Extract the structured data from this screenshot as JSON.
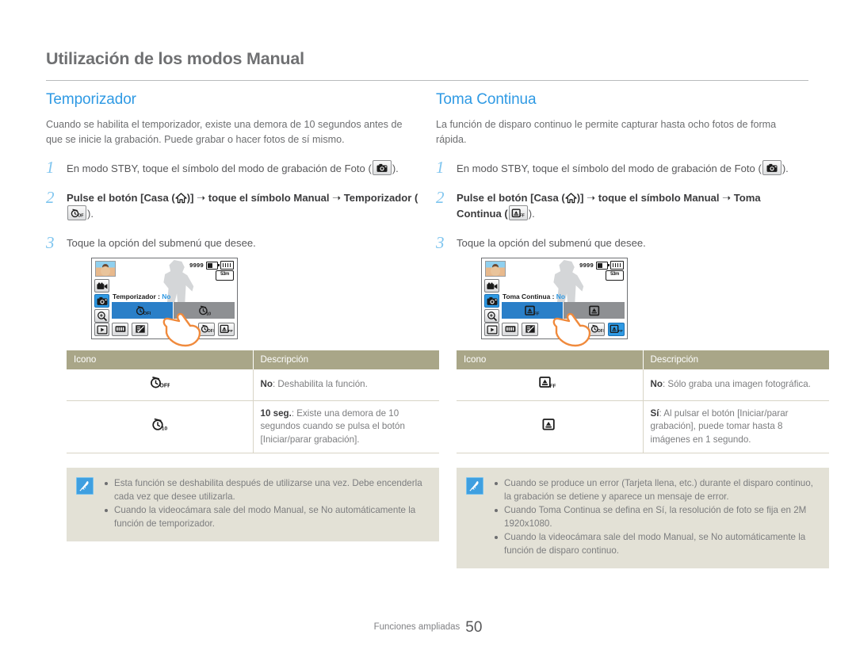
{
  "header": {
    "title": "Utilización de los modos Manual"
  },
  "footer": {
    "section": "Funciones ampliadas",
    "page": "50"
  },
  "left": {
    "heading": "Temporizador",
    "intro": "Cuando se habilita el temporizador, existe una demora de 10 segundos antes de que se inicie la grabación. Puede grabar o hacer fotos de sí mismo.",
    "steps": [
      {
        "num": "1",
        "html_pre": "En modo STBY, toque el símbolo del modo de grabación de Foto (",
        "html_post": ")."
      },
      {
        "num": "2",
        "html_pre": "Pulse el botón [Casa (",
        "mid": ")] ➝ toque el símbolo Manual ➝ Temporizador (",
        "html_post": ")."
      },
      {
        "num": "3",
        "text": "Toque la opción del submenú que desee."
      }
    ],
    "lcd": {
      "counter": "9999",
      "rec_badge": "53m",
      "label": "Temporizador :",
      "value": "No",
      "option_left": "off-timer-icon",
      "option_right": "timer-10s-icon"
    },
    "table": {
      "headers": [
        "Icono",
        "Descripción"
      ],
      "rows": [
        {
          "icon": "timer-off-icon",
          "bold": "No",
          "text": ": Deshabilita la función."
        },
        {
          "icon": "timer-10s-icon",
          "bold": "10 seg.",
          "text": ": Existe una demora de 10 segundos cuando se pulsa el botón [Iniciar/parar grabación]."
        }
      ]
    },
    "note": {
      "items": [
        "Esta función se deshabilita después de utilizarse una vez. Debe encenderla cada vez que desee utilizarla.",
        "Cuando la videocámara sale del modo Manual, se No automáticamente la función de temporizador."
      ]
    }
  },
  "right": {
    "heading": "Toma Continua",
    "intro": "La función de disparo continuo le permite capturar hasta ocho fotos de forma rápida.",
    "steps": [
      {
        "num": "1",
        "html_pre": "En modo STBY, toque el símbolo del modo de grabación de Foto (",
        "html_post": ")."
      },
      {
        "num": "2",
        "html_pre": "Pulse el botón [Casa (",
        "mid": ")] ➝ toque el símbolo Manual ➝ Toma Continua (",
        "html_post": ")."
      },
      {
        "num": "3",
        "text": "Toque la opción del submenú que desee."
      }
    ],
    "lcd": {
      "counter": "9999",
      "rec_badge": "53m",
      "label": "Toma Continua :",
      "value": "No",
      "option_left": "burst-off-icon",
      "option_right": "burst-on-icon"
    },
    "table": {
      "headers": [
        "Icono",
        "Descripción"
      ],
      "rows": [
        {
          "icon": "burst-off-icon",
          "bold": "No",
          "text": ": Sólo graba una imagen fotográfica."
        },
        {
          "icon": "burst-on-icon",
          "bold": "Sí",
          "text": ": Al pulsar el botón [Iniciar/parar grabación], puede tomar hasta 8 imágenes en 1 segundo."
        }
      ]
    },
    "note": {
      "items": [
        "Cuando se produce un error (Tarjeta llena, etc.) durante el disparo continuo, la grabación se detiene y aparece un mensaje de error.",
        "Cuando Toma Continua se defina en Sí, la resolución de foto se fija en 2M 1920x1080.",
        "Cuando la videocámara sale del modo Manual, se No automáticamente la función de disparo continuo."
      ]
    }
  },
  "colors": {
    "accent": "#2f9ae4",
    "table_header": "#a9a688",
    "note_bg": "#e3e1d6",
    "step_num": "#7fc5ef"
  }
}
